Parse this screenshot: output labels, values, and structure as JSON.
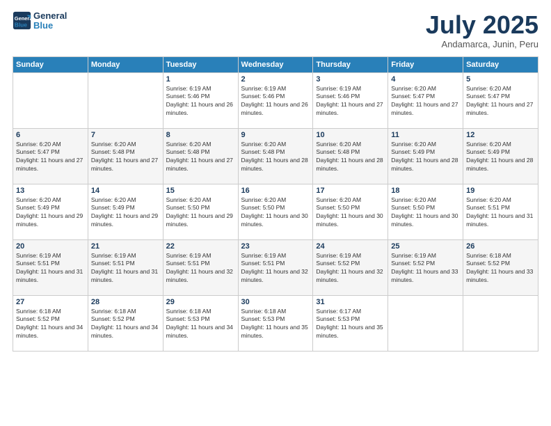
{
  "logo": {
    "line1": "General",
    "line2": "Blue"
  },
  "title": "July 2025",
  "subtitle": "Andamarca, Junin, Peru",
  "days_of_week": [
    "Sunday",
    "Monday",
    "Tuesday",
    "Wednesday",
    "Thursday",
    "Friday",
    "Saturday"
  ],
  "weeks": [
    [
      {
        "day": "",
        "sunrise": "",
        "sunset": "",
        "daylight": ""
      },
      {
        "day": "",
        "sunrise": "",
        "sunset": "",
        "daylight": ""
      },
      {
        "day": "1",
        "sunrise": "Sunrise: 6:19 AM",
        "sunset": "Sunset: 5:46 PM",
        "daylight": "Daylight: 11 hours and 26 minutes."
      },
      {
        "day": "2",
        "sunrise": "Sunrise: 6:19 AM",
        "sunset": "Sunset: 5:46 PM",
        "daylight": "Daylight: 11 hours and 26 minutes."
      },
      {
        "day": "3",
        "sunrise": "Sunrise: 6:19 AM",
        "sunset": "Sunset: 5:46 PM",
        "daylight": "Daylight: 11 hours and 27 minutes."
      },
      {
        "day": "4",
        "sunrise": "Sunrise: 6:20 AM",
        "sunset": "Sunset: 5:47 PM",
        "daylight": "Daylight: 11 hours and 27 minutes."
      },
      {
        "day": "5",
        "sunrise": "Sunrise: 6:20 AM",
        "sunset": "Sunset: 5:47 PM",
        "daylight": "Daylight: 11 hours and 27 minutes."
      }
    ],
    [
      {
        "day": "6",
        "sunrise": "Sunrise: 6:20 AM",
        "sunset": "Sunset: 5:47 PM",
        "daylight": "Daylight: 11 hours and 27 minutes."
      },
      {
        "day": "7",
        "sunrise": "Sunrise: 6:20 AM",
        "sunset": "Sunset: 5:48 PM",
        "daylight": "Daylight: 11 hours and 27 minutes."
      },
      {
        "day": "8",
        "sunrise": "Sunrise: 6:20 AM",
        "sunset": "Sunset: 5:48 PM",
        "daylight": "Daylight: 11 hours and 27 minutes."
      },
      {
        "day": "9",
        "sunrise": "Sunrise: 6:20 AM",
        "sunset": "Sunset: 5:48 PM",
        "daylight": "Daylight: 11 hours and 28 minutes."
      },
      {
        "day": "10",
        "sunrise": "Sunrise: 6:20 AM",
        "sunset": "Sunset: 5:48 PM",
        "daylight": "Daylight: 11 hours and 28 minutes."
      },
      {
        "day": "11",
        "sunrise": "Sunrise: 6:20 AM",
        "sunset": "Sunset: 5:49 PM",
        "daylight": "Daylight: 11 hours and 28 minutes."
      },
      {
        "day": "12",
        "sunrise": "Sunrise: 6:20 AM",
        "sunset": "Sunset: 5:49 PM",
        "daylight": "Daylight: 11 hours and 28 minutes."
      }
    ],
    [
      {
        "day": "13",
        "sunrise": "Sunrise: 6:20 AM",
        "sunset": "Sunset: 5:49 PM",
        "daylight": "Daylight: 11 hours and 29 minutes."
      },
      {
        "day": "14",
        "sunrise": "Sunrise: 6:20 AM",
        "sunset": "Sunset: 5:49 PM",
        "daylight": "Daylight: 11 hours and 29 minutes."
      },
      {
        "day": "15",
        "sunrise": "Sunrise: 6:20 AM",
        "sunset": "Sunset: 5:50 PM",
        "daylight": "Daylight: 11 hours and 29 minutes."
      },
      {
        "day": "16",
        "sunrise": "Sunrise: 6:20 AM",
        "sunset": "Sunset: 5:50 PM",
        "daylight": "Daylight: 11 hours and 30 minutes."
      },
      {
        "day": "17",
        "sunrise": "Sunrise: 6:20 AM",
        "sunset": "Sunset: 5:50 PM",
        "daylight": "Daylight: 11 hours and 30 minutes."
      },
      {
        "day": "18",
        "sunrise": "Sunrise: 6:20 AM",
        "sunset": "Sunset: 5:50 PM",
        "daylight": "Daylight: 11 hours and 30 minutes."
      },
      {
        "day": "19",
        "sunrise": "Sunrise: 6:20 AM",
        "sunset": "Sunset: 5:51 PM",
        "daylight": "Daylight: 11 hours and 31 minutes."
      }
    ],
    [
      {
        "day": "20",
        "sunrise": "Sunrise: 6:19 AM",
        "sunset": "Sunset: 5:51 PM",
        "daylight": "Daylight: 11 hours and 31 minutes."
      },
      {
        "day": "21",
        "sunrise": "Sunrise: 6:19 AM",
        "sunset": "Sunset: 5:51 PM",
        "daylight": "Daylight: 11 hours and 31 minutes."
      },
      {
        "day": "22",
        "sunrise": "Sunrise: 6:19 AM",
        "sunset": "Sunset: 5:51 PM",
        "daylight": "Daylight: 11 hours and 32 minutes."
      },
      {
        "day": "23",
        "sunrise": "Sunrise: 6:19 AM",
        "sunset": "Sunset: 5:51 PM",
        "daylight": "Daylight: 11 hours and 32 minutes."
      },
      {
        "day": "24",
        "sunrise": "Sunrise: 6:19 AM",
        "sunset": "Sunset: 5:52 PM",
        "daylight": "Daylight: 11 hours and 32 minutes."
      },
      {
        "day": "25",
        "sunrise": "Sunrise: 6:19 AM",
        "sunset": "Sunset: 5:52 PM",
        "daylight": "Daylight: 11 hours and 33 minutes."
      },
      {
        "day": "26",
        "sunrise": "Sunrise: 6:18 AM",
        "sunset": "Sunset: 5:52 PM",
        "daylight": "Daylight: 11 hours and 33 minutes."
      }
    ],
    [
      {
        "day": "27",
        "sunrise": "Sunrise: 6:18 AM",
        "sunset": "Sunset: 5:52 PM",
        "daylight": "Daylight: 11 hours and 34 minutes."
      },
      {
        "day": "28",
        "sunrise": "Sunrise: 6:18 AM",
        "sunset": "Sunset: 5:52 PM",
        "daylight": "Daylight: 11 hours and 34 minutes."
      },
      {
        "day": "29",
        "sunrise": "Sunrise: 6:18 AM",
        "sunset": "Sunset: 5:53 PM",
        "daylight": "Daylight: 11 hours and 34 minutes."
      },
      {
        "day": "30",
        "sunrise": "Sunrise: 6:18 AM",
        "sunset": "Sunset: 5:53 PM",
        "daylight": "Daylight: 11 hours and 35 minutes."
      },
      {
        "day": "31",
        "sunrise": "Sunrise: 6:17 AM",
        "sunset": "Sunset: 5:53 PM",
        "daylight": "Daylight: 11 hours and 35 minutes."
      },
      {
        "day": "",
        "sunrise": "",
        "sunset": "",
        "daylight": ""
      },
      {
        "day": "",
        "sunrise": "",
        "sunset": "",
        "daylight": ""
      }
    ]
  ]
}
